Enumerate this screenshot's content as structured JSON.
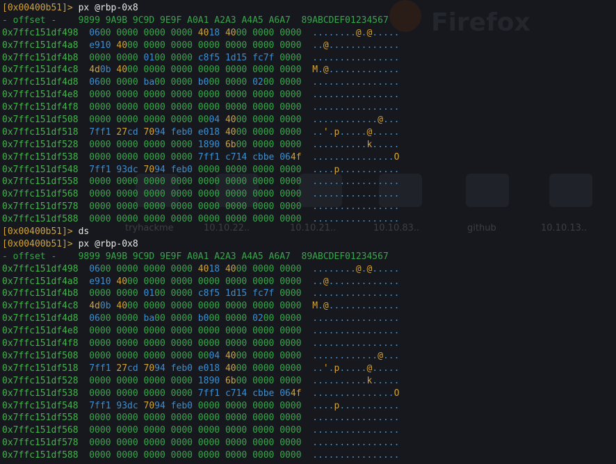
{
  "background_apptitle": "Firefox",
  "background_tiles": [
    "tryhackme",
    "10.10.22..",
    "10.10.21..",
    "10.10.83..",
    "github",
    "10.10.13.."
  ],
  "prompt": {
    "address": "0x00400b51"
  },
  "blocks": [
    {
      "command": "px @rbp-0x8"
    },
    {
      "command": "ds"
    },
    {
      "command": "px @rbp-0x8"
    }
  ],
  "hexdump": {
    "header": {
      "offset": "- offset -",
      "columns": [
        "9899",
        "9A9B",
        "9C9D",
        "9E9F",
        "A0A1",
        "A2A3",
        "A4A5",
        "A6A7"
      ],
      "ascii": "89ABCDEF01234567"
    },
    "rows": [
      {
        "addr": "0x7ffc151df498",
        "cols": [
          "0600",
          "0000",
          "0000",
          "0000",
          "4018",
          "4000",
          "0000",
          "0000"
        ],
        "ascii": "........@.@....."
      },
      {
        "addr": "0x7ffc151df4a8",
        "cols": [
          "e910",
          "4000",
          "0000",
          "0000",
          "0000",
          "0000",
          "0000",
          "0000"
        ],
        "ascii": "..@............."
      },
      {
        "addr": "0x7ffc151df4b8",
        "cols": [
          "0000",
          "0000",
          "0100",
          "0000",
          "c8f5",
          "1d15",
          "fc7f",
          "0000"
        ],
        "ascii": "................"
      },
      {
        "addr": "0x7ffc151df4c8",
        "cols": [
          "4d0b",
          "4000",
          "0000",
          "0000",
          "0000",
          "0000",
          "0000",
          "0000"
        ],
        "ascii": "M.@............."
      },
      {
        "addr": "0x7ffc151df4d8",
        "cols": [
          "0600",
          "0000",
          "ba00",
          "0000",
          "b000",
          "0000",
          "0200",
          "0000"
        ],
        "ascii": "................"
      },
      {
        "addr": "0x7ffc151df4e8",
        "cols": [
          "0000",
          "0000",
          "0000",
          "0000",
          "0000",
          "0000",
          "0000",
          "0000"
        ],
        "ascii": "................"
      },
      {
        "addr": "0x7ffc151df4f8",
        "cols": [
          "0000",
          "0000",
          "0000",
          "0000",
          "0000",
          "0000",
          "0000",
          "0000"
        ],
        "ascii": "................"
      },
      {
        "addr": "0x7ffc151df508",
        "cols": [
          "0000",
          "0000",
          "0000",
          "0000",
          "0004",
          "4000",
          "0000",
          "0000"
        ],
        "ascii": "............@..."
      },
      {
        "addr": "0x7ffc151df518",
        "cols": [
          "7ff1",
          "27cd",
          "7094",
          "feb0",
          "e018",
          "4000",
          "0000",
          "0000"
        ],
        "ascii": "..'.p.....@....."
      },
      {
        "addr": "0x7ffc151df528",
        "cols": [
          "0000",
          "0000",
          "0000",
          "0000",
          "1890",
          "6b00",
          "0000",
          "0000"
        ],
        "ascii": "..........k....."
      },
      {
        "addr": "0x7ffc151df538",
        "cols": [
          "0000",
          "0000",
          "0000",
          "0000",
          "7ff1",
          "c714",
          "cbbe",
          "064f"
        ],
        "ascii": "...............O"
      },
      {
        "addr": "0x7ffc151df548",
        "cols": [
          "7ff1",
          "93dc",
          "7094",
          "feb0",
          "0000",
          "0000",
          "0000",
          "0000"
        ],
        "ascii": "....p..........."
      },
      {
        "addr": "0x7ffc151df558",
        "cols": [
          "0000",
          "0000",
          "0000",
          "0000",
          "0000",
          "0000",
          "0000",
          "0000"
        ],
        "ascii": "................"
      },
      {
        "addr": "0x7ffc151df568",
        "cols": [
          "0000",
          "0000",
          "0000",
          "0000",
          "0000",
          "0000",
          "0000",
          "0000"
        ],
        "ascii": "................"
      },
      {
        "addr": "0x7ffc151df578",
        "cols": [
          "0000",
          "0000",
          "0000",
          "0000",
          "0000",
          "0000",
          "0000",
          "0000"
        ],
        "ascii": "................"
      },
      {
        "addr": "0x7ffc151df588",
        "cols": [
          "0000",
          "0000",
          "0000",
          "0000",
          "0000",
          "0000",
          "0000",
          "0000"
        ],
        "ascii": "................"
      }
    ]
  },
  "colors": {
    "background": "#16181d",
    "prompt": "#d3a435",
    "address": "#47b34e",
    "zero_byte": "#3aa64c",
    "printable_byte": "#d3a435",
    "other_byte": "#3d8fd0"
  }
}
